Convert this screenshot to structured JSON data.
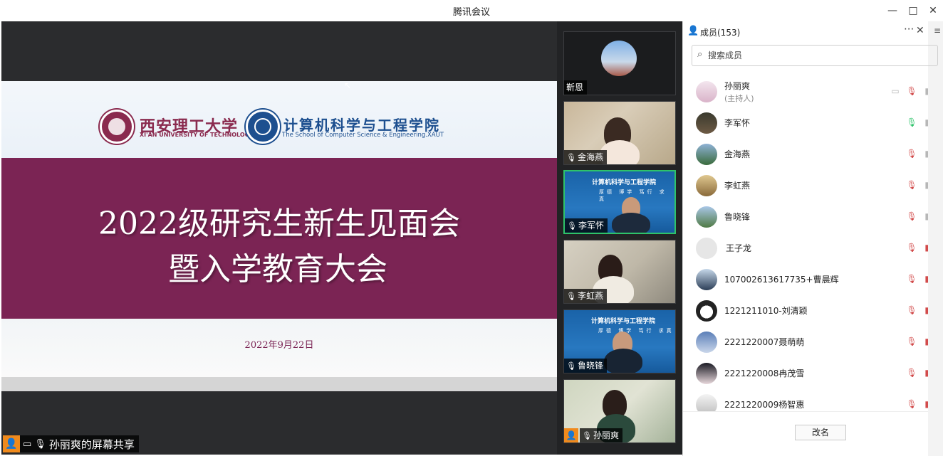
{
  "window": {
    "title": "腾讯会议",
    "minimize": "—",
    "maximize": "□",
    "close": "✕"
  },
  "share": {
    "slide": {
      "school_cn": "西安理工大学",
      "school_en": "XI'AN UNIVERSITY OF TECHNOLOGY",
      "college_cn": "计算机科学与工程学院",
      "college_en": "The School of Computer Science & Engineering.XAUT",
      "title_line1": "2022级研究生新生见面会",
      "title_line2": "暨入学教育大会",
      "date": "2022年9月22日"
    },
    "label": "孙丽爽的屏幕共享"
  },
  "videos": [
    {
      "name": "靳恩"
    },
    {
      "name": "金海燕"
    },
    {
      "name": "李军怀"
    },
    {
      "name": "李虹燕"
    },
    {
      "name": "鲁晓锋"
    },
    {
      "name": "孙丽爽"
    }
  ],
  "members": {
    "title": "成员(153)",
    "search_placeholder": "搜索成员",
    "rename_label": "改名",
    "list": [
      {
        "name": "孙丽爽",
        "sub": "(主持人)",
        "mic": "muted",
        "cam": "on"
      },
      {
        "name": "李军怀",
        "mic": "live",
        "cam": "on"
      },
      {
        "name": "金海燕",
        "mic": "muted",
        "cam": "on"
      },
      {
        "name": "李虹燕",
        "mic": "muted",
        "cam": "on"
      },
      {
        "name": "鲁晓锋",
        "mic": "muted",
        "cam": "on"
      },
      {
        "name": "王子龙",
        "mic": "muted",
        "cam": "off"
      },
      {
        "name": "107002613617735+曹晨辉",
        "mic": "muted",
        "cam": "off"
      },
      {
        "name": "1221211010-刘清颖",
        "mic": "muted",
        "cam": "off"
      },
      {
        "name": "2221220007聂萌萌",
        "mic": "muted",
        "cam": "off"
      },
      {
        "name": "2221220008冉茂雪",
        "mic": "muted",
        "cam": "off"
      },
      {
        "name": "2221220009杨智惠",
        "mic": "muted",
        "cam": "off"
      }
    ]
  },
  "colors": {
    "accent_green": "#2ec36a",
    "slide_band": "#7b2454",
    "muted_red": "#d24b4b",
    "orange": "#f08a1c"
  }
}
